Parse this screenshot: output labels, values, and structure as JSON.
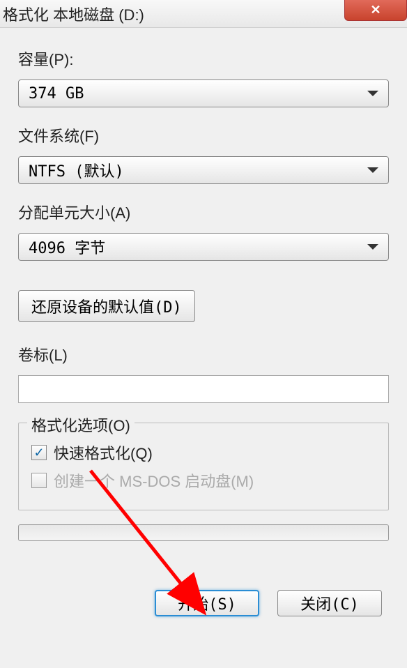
{
  "title": "格式化 本地磁盘 (D:)",
  "close_x": "✕",
  "capacity": {
    "label": "容量(P):",
    "value": "374 GB"
  },
  "filesystem": {
    "label": "文件系统(F)",
    "value": "NTFS (默认)"
  },
  "allocation": {
    "label": "分配单元大小(A)",
    "value": "4096 字节"
  },
  "restore_defaults": "还原设备的默认值(D)",
  "volume_label": {
    "label": "卷标(L)",
    "value": ""
  },
  "options": {
    "legend": "格式化选项(O)",
    "quick_format": {
      "label": "快速格式化(Q)",
      "checked": true
    },
    "msdos_disk": {
      "label": "创建一个 MS-DOS 启动盘(M)",
      "checked": false,
      "disabled": true
    }
  },
  "buttons": {
    "start": "开始(S)",
    "close": "关闭(C)"
  }
}
